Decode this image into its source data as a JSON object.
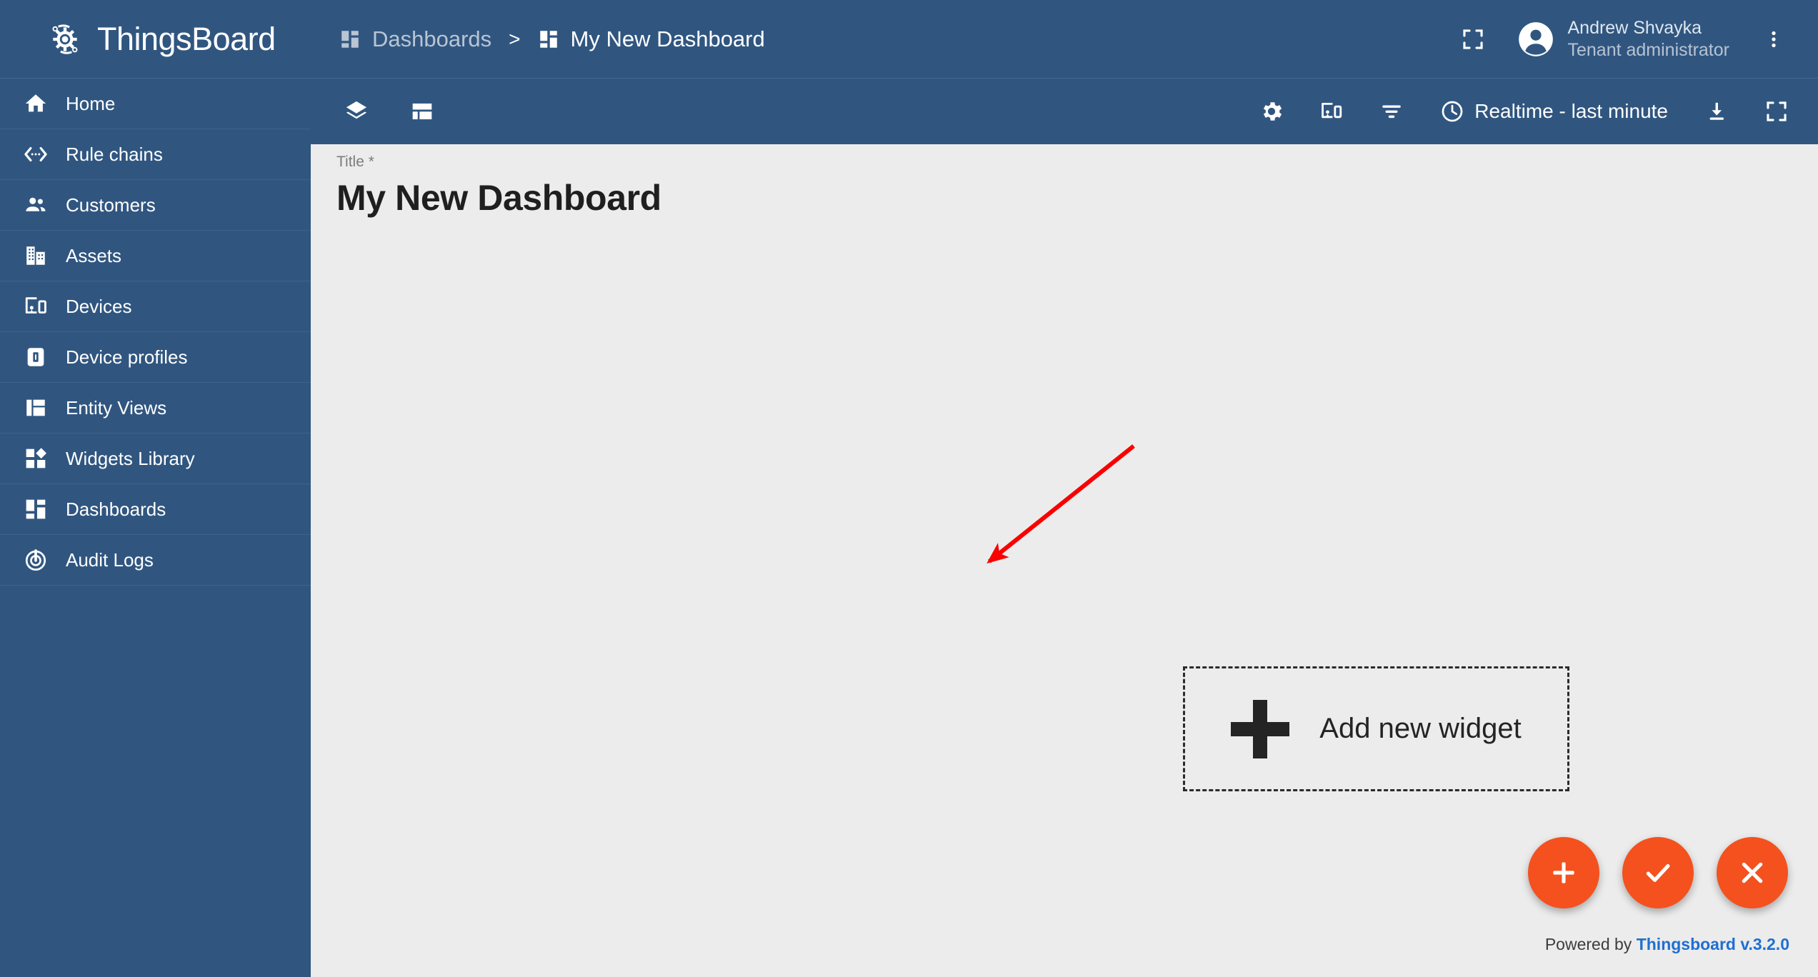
{
  "brand": {
    "name": "ThingsBoard",
    "logo_icon": "thingsboard-gear-logo",
    "sidebar_color": "#305680",
    "accent_color": "#f4511e",
    "content_background": "#ececec"
  },
  "sidebar": {
    "items": [
      {
        "label": "Home",
        "icon": "home-icon"
      },
      {
        "label": "Rule chains",
        "icon": "rule-chains-icon"
      },
      {
        "label": "Customers",
        "icon": "customers-icon"
      },
      {
        "label": "Assets",
        "icon": "assets-icon"
      },
      {
        "label": "Devices",
        "icon": "devices-icon"
      },
      {
        "label": "Device profiles",
        "icon": "device-profiles-icon"
      },
      {
        "label": "Entity Views",
        "icon": "entity-views-icon"
      },
      {
        "label": "Widgets Library",
        "icon": "widgets-library-icon"
      },
      {
        "label": "Dashboards",
        "icon": "dashboards-icon"
      },
      {
        "label": "Audit Logs",
        "icon": "audit-logs-icon"
      }
    ]
  },
  "topbar": {
    "breadcrumb": [
      {
        "label": "Dashboards",
        "icon": "dashboards-icon",
        "active": false
      },
      {
        "label": "My New Dashboard",
        "icon": "dashboards-icon",
        "active": true
      }
    ],
    "separator": ">",
    "fullscreen_icon": "fullscreen-icon",
    "more_icon": "more-vertical-icon",
    "user": {
      "name": "Andrew Shvayka",
      "role": "Tenant administrator",
      "avatar_icon": "user-avatar-icon"
    }
  },
  "dashboard_toolbar": {
    "left_icons": [
      {
        "name": "layers-icon"
      },
      {
        "name": "dashboard-layout-icon"
      }
    ],
    "right_icons": [
      {
        "name": "settings-gear-icon"
      },
      {
        "name": "manage-devices-icon"
      },
      {
        "name": "filters-icon"
      }
    ],
    "time_window": {
      "label": "Realtime - last minute",
      "icon": "clock-icon"
    },
    "export_icon": "download-icon",
    "expand_icon": "fullscreen-icon"
  },
  "content": {
    "title_label": "Title *",
    "title_value": "My New Dashboard",
    "add_widget": {
      "label": "Add new widget",
      "icon": "plus-icon"
    },
    "annotation": {
      "type": "arrow",
      "color": "#fb0000"
    }
  },
  "fabs": [
    {
      "name": "add-widget-fab",
      "icon": "plus-icon"
    },
    {
      "name": "apply-changes-fab",
      "icon": "check-icon"
    },
    {
      "name": "cancel-changes-fab",
      "icon": "close-icon"
    }
  ],
  "footer": {
    "prefix": "Powered by",
    "link": "Thingsboard v.3.2.0"
  }
}
